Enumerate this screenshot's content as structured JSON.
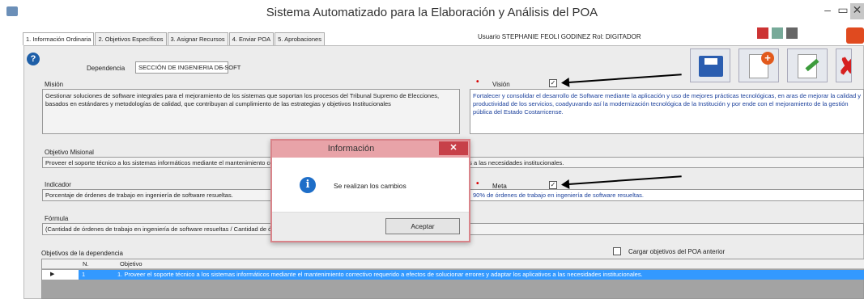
{
  "window": {
    "title": "Sistema Automatizado para la Elaboración y Análisis del POA"
  },
  "tabs": [
    "1. Información Ordinaria",
    "2. Objetivos Específicos",
    "3. Asignar Recursos",
    "4. Enviar POA",
    "5. Aprobaciones"
  ],
  "user_info": "Usuario STEPHANIE FEOLI GODINEZ  Rol: DIGITADOR",
  "dependencia": {
    "label": "Dependencia",
    "value": "SECCIÓN DE INGENIERIA DE SOFT"
  },
  "mision": {
    "label": "Misión",
    "text": "Gestionar soluciones de software integrales para el mejoramiento de los sistemas que soportan los procesos del Tribunal Supremo de Elecciones, basados en estándares y metodologías de calidad, que contribuyan al cumplimiento de las estrategias y objetivos Institucionales"
  },
  "vision": {
    "label": "Visión",
    "text": "Fortalecer y consolidar el  desarrollo de Software mediante la aplicación y uso de mejores prácticas tecnológicas,  en aras de mejorar   la calidad y productividad de los servicios,  coadyuvando así la modernización tecnológica de la Institución y por ende con el  mejoramiento de la gestión pública del Estado Costarricense."
  },
  "objetivo_misional": {
    "label": "Objetivo Misional",
    "text": "Proveer el soporte técnico a los sistemas informáticos mediante el mantenimiento correctivo requerido a efectos de solucionar errores y adaptar los aplicativos a las necesidades institucionales."
  },
  "indicador": {
    "label": "Indicador",
    "text": "Porcentaje de órdenes de trabajo en ingeniería de software resueltas."
  },
  "meta": {
    "label": "Meta",
    "text": "90% de órdenes de trabajo en ingeniería de software resueltas."
  },
  "formula": {
    "label": "Fórmula",
    "text": "(Cantidad de órdenes de trabajo en ingeniería de software resueltas / Cantidad de órdenes de trabajo en ingeniería de software recibidas) * 100"
  },
  "objetivos": {
    "label": "Objetivos de la dependencia",
    "cargar_label": "Cargar objetivos del POA anterior",
    "col_n": "N.",
    "col_objetivo": "Objetivo",
    "row_indicator": "▶",
    "rows": [
      {
        "n": "1",
        "objetivo": "1. Proveer el soporte técnico a los sistemas informáticos mediante el mantenimiento correctivo requerido a efectos de solucionar errores y adaptar los aplicativos a las necesidades institucionales."
      }
    ]
  },
  "dialog": {
    "title": "Información",
    "close": "✕",
    "message": "Se realizan los cambios",
    "ok": "Aceptar"
  },
  "glyphs": {
    "help": "?",
    "info": "i",
    "required": "•",
    "check": "✓",
    "min": "–",
    "max": "▭",
    "close": "✕",
    "caret": "⌄",
    "delete": "✘"
  },
  "colors": {
    "dialog_header": "#e8a3a8",
    "dialog_close": "#c74049",
    "selection": "#3399ff",
    "exit": "#e04a1f"
  }
}
